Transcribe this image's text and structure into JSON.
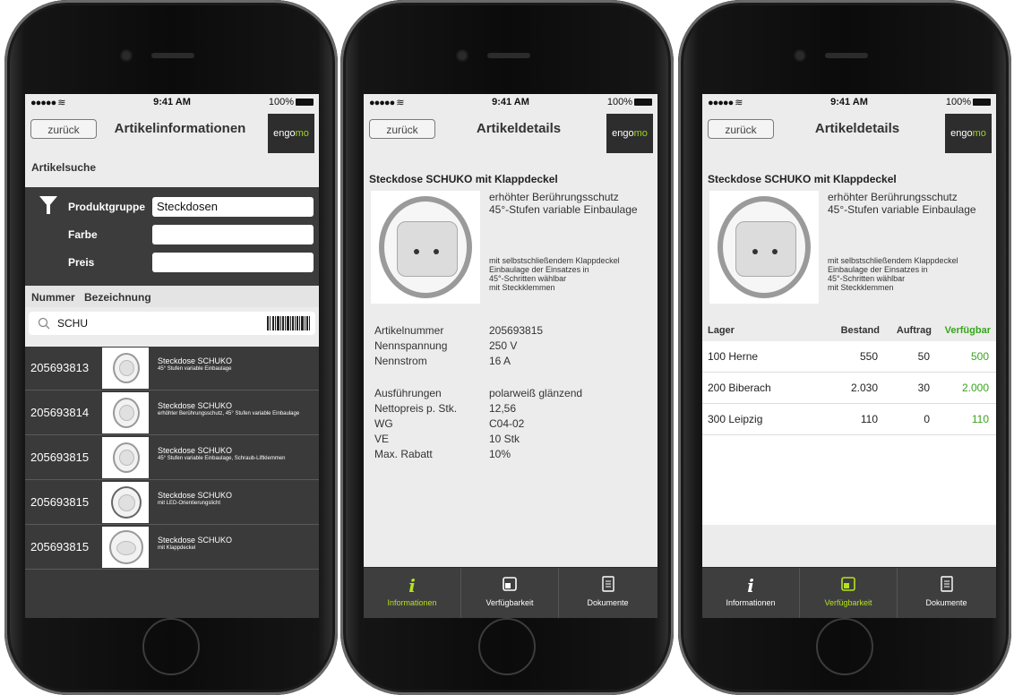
{
  "status": {
    "signal": "●●●●● ≋",
    "time": "9:41 AM",
    "battery": "100%"
  },
  "brand": {
    "logo_a": "engo",
    "logo_b": "mo",
    "accent": "#b4e31c",
    "available": "#38a51c"
  },
  "back_label": "zurück",
  "screen1": {
    "title": "Artikelinformationen",
    "search_section": "Artikelsuche",
    "filters": [
      {
        "label": "Produktgruppe",
        "value": "Steckdosen"
      },
      {
        "label": "Farbe",
        "value": ""
      },
      {
        "label": "Preis",
        "value": ""
      }
    ],
    "columns": {
      "number": "Nummer",
      "name": "Bezeichnung"
    },
    "search_value": "SCHU",
    "barcode_icon": "barcode-icon",
    "results": [
      {
        "number": "205693813",
        "title": "Steckdose SCHUKO",
        "subtitle": "45° Stufen variable Einbaulage"
      },
      {
        "number": "205693814",
        "title": "Steckdose SCHUKO",
        "subtitle": "erhöhter Berührungsschutz, 45° Stufen variable Einbaulage"
      },
      {
        "number": "205693815",
        "title": "Steckdose SCHUKO",
        "subtitle": "45° Stufen variable Einbaulage, Schraub-Liftklemmen"
      },
      {
        "number": "205693815",
        "title": "Steckdose SCHUKO",
        "subtitle": "mit LED-Orientierungslicht"
      },
      {
        "number": "205693815",
        "title": "Steckdose SCHUKO",
        "subtitle": "mit Klappdeckel"
      }
    ]
  },
  "product": {
    "title": "Steckdose SCHUKO mit Klappdeckel",
    "features": [
      "erhöhter Berührungsschutz",
      "45°-Stufen variable Einbaulage"
    ],
    "features_small": [
      "mit selbstschließendem Klappdeckel",
      "Einbaulage der Einsatzes in",
      "45°-Schritten wählbar",
      "mit Steckklemmen"
    ]
  },
  "screen2": {
    "title": "Artikeldetails",
    "specs": [
      {
        "label": "Artikelnummer",
        "value": "205693815"
      },
      {
        "label": "Nennspannung",
        "value": "250 V"
      },
      {
        "label": "Nennstrom",
        "value": "16 A"
      }
    ],
    "specs2": [
      {
        "label": "Ausführungen",
        "value": "polarweiß glänzend"
      },
      {
        "label": "Nettopreis p. Stk.",
        "value": "12,56"
      },
      {
        "label": "WG",
        "value": "C04-02"
      },
      {
        "label": "VE",
        "value": "10 Stk"
      },
      {
        "label": "Max. Rabatt",
        "value": "10%"
      }
    ]
  },
  "screen3": {
    "title": "Artikeldetails",
    "headers": {
      "lager": "Lager",
      "bestand": "Bestand",
      "auftrag": "Auftrag",
      "verfuegbar": "Verfügbar"
    },
    "rows": [
      {
        "lager": "100 Herne",
        "bestand": "550",
        "auftrag": "50",
        "verfuegbar": "500"
      },
      {
        "lager": "200 Biberach",
        "bestand": "2.030",
        "auftrag": "30",
        "verfuegbar": "2.000"
      },
      {
        "lager": "300 Leipzig",
        "bestand": "110",
        "auftrag": "0",
        "verfuegbar": "110"
      }
    ]
  },
  "tabs": [
    {
      "label": "Informationen",
      "icon": "info-icon"
    },
    {
      "label": "Verfügbarkeit",
      "icon": "warehouse-icon"
    },
    {
      "label": "Dokumente",
      "icon": "document-icon"
    }
  ]
}
